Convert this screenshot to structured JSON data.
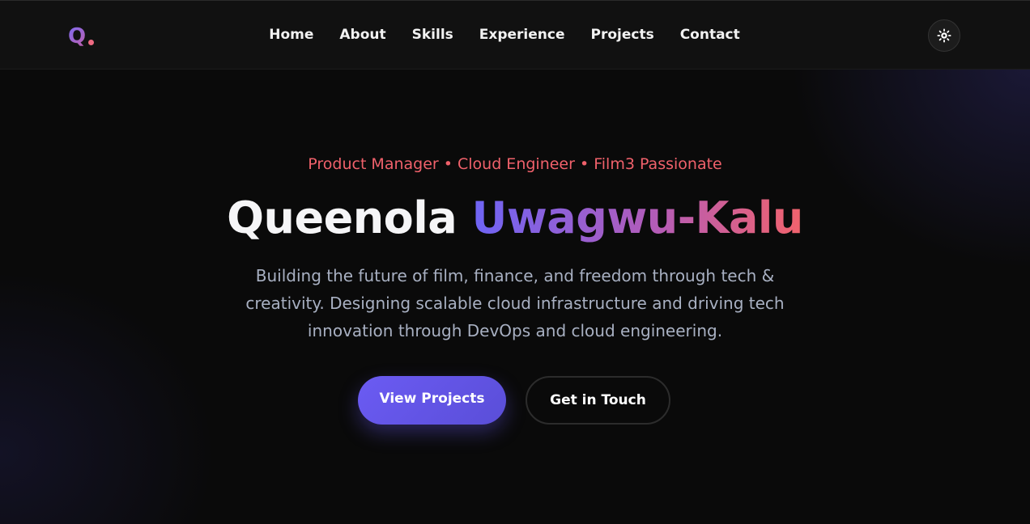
{
  "brand": {
    "logo_letter": "Q",
    "logo_icon": "q-dot-logo",
    "colors": {
      "gradient_start": "#7b6cf6",
      "gradient_end": "#c15ea7",
      "dot": "#ee6a82"
    }
  },
  "nav": {
    "links": [
      {
        "label": "Home"
      },
      {
        "label": "About"
      },
      {
        "label": "Skills"
      },
      {
        "label": "Experience"
      },
      {
        "label": "Projects"
      },
      {
        "label": "Contact"
      }
    ],
    "theme_toggle_icon": "sun-icon"
  },
  "hero": {
    "roles": "Product Manager • Cloud Engineer • Film3 Passionate",
    "first_name": "Queenola",
    "last_name": "Uwagwu-Kalu",
    "intro": "Building the future of film, finance, and freedom through tech & creativity. Designing scalable cloud infrastructure and driving tech innovation through DevOps and cloud engineering.",
    "primary_cta": "View Projects",
    "secondary_cta": "Get in Touch"
  },
  "colors": {
    "accent_red": "#f0616b",
    "accent_purple": "#6e64f5",
    "button_primary": "#6b5bf3",
    "background": "#0a0a0a",
    "nav_background": "#111111"
  }
}
